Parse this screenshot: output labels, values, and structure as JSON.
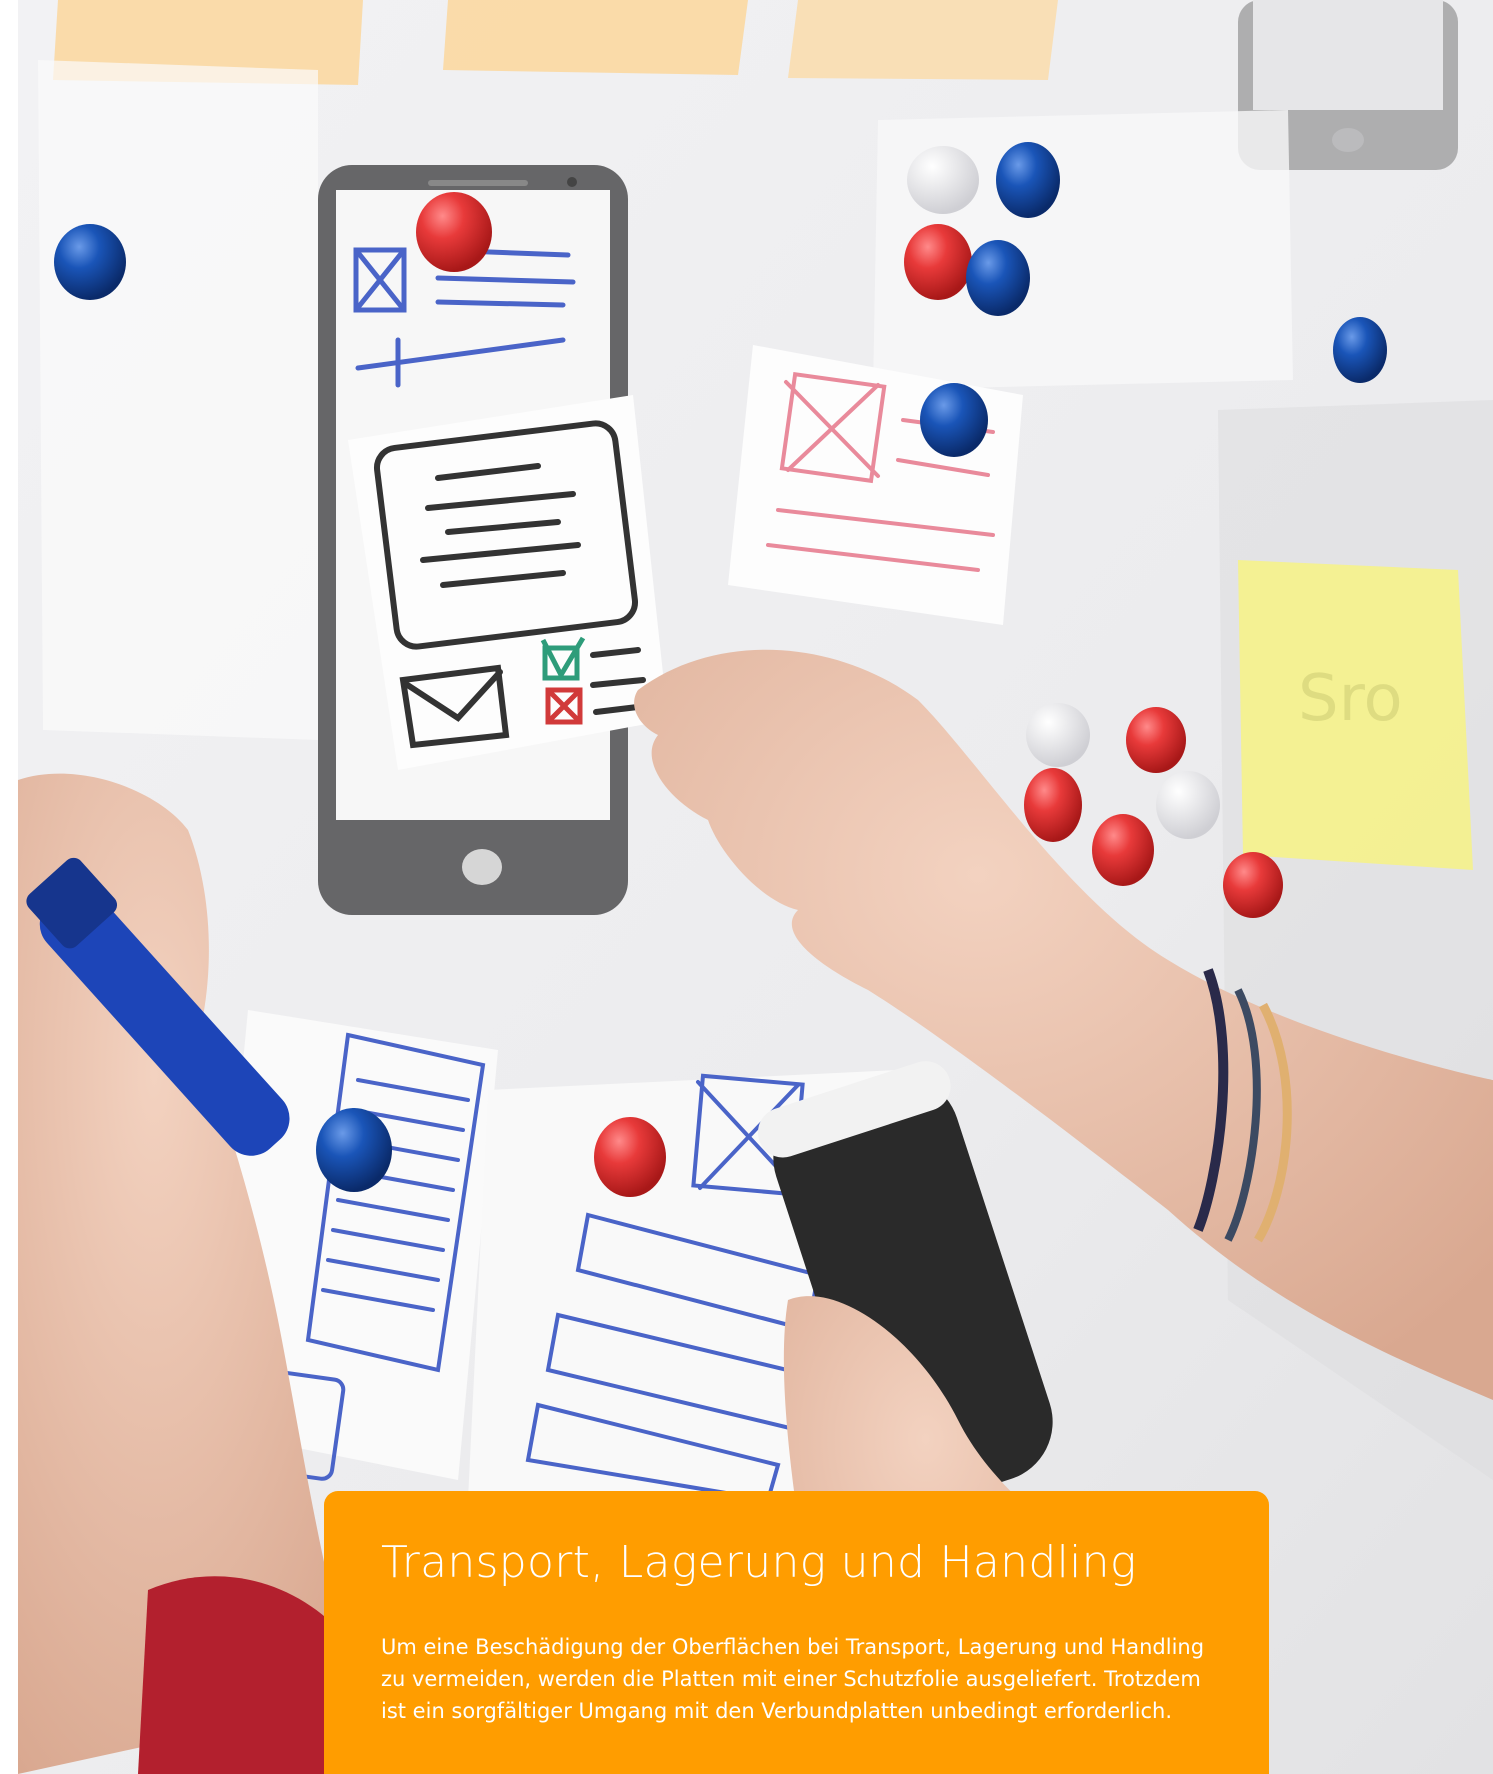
{
  "photo": {
    "description_icon": "whiteboard-wireframe-photo",
    "sticky_note_text": "Sro"
  },
  "info_card": {
    "title": "Transport, Lagerung und Handling",
    "body": "Um eine Beschädigung der Oberflächen bei Transport, Lagerung und Handling zu vermeiden, werden die Platten mit einer Schutzfolie ausgeliefert. Trotzdem ist ein sorgfältiger Umgang mit den Verbundplatten unbedingt erforderlich.",
    "background_color": "#ff9d00",
    "text_color": "#ffffff"
  }
}
